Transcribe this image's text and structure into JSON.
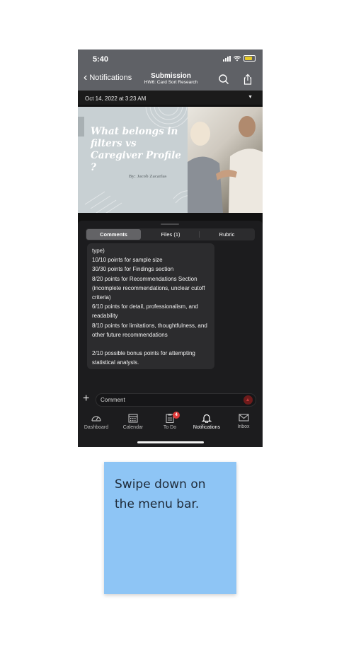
{
  "status_bar": {
    "time": "5:40"
  },
  "nav": {
    "back_label": "Notifications",
    "title": "Submission",
    "subtitle": "HW6: Card Sort Research"
  },
  "submission": {
    "date": "Oct 14, 2022 at 3:23 AM",
    "dropdown_icon": "triangle-down-icon"
  },
  "slide": {
    "title": "What belongs in filters vs Caregiver Profile ?",
    "author": "By: Jacob Zacarias"
  },
  "tabs": {
    "comments": "Comments",
    "files": "Files (1)",
    "rubric": "Rubric",
    "selected": "Comments"
  },
  "comment_text": "type)\n10/10 points for sample size\n30/30 points for Findings section\n8/20 points for Recommendations Section (incomplete recommendations, unclear cutoff criteria)\n6/10 points for detail, professionalism, and readability\n8/10 points for limitations, thoughtfulness, and other future recommendations\n\n2/10 possible bonus points for attempting statistical analysis.",
  "comment_input": {
    "placeholder": "Comment"
  },
  "tabbar": {
    "dashboard": "Dashboard",
    "calendar": "Calendar",
    "todo": "To Do",
    "todo_badge": "4",
    "notifications": "Notifications",
    "inbox": "Inbox",
    "active": "Notifications"
  },
  "instruction": "Swipe down on the menu bar.",
  "colors": {
    "badge": "#e03b3b",
    "note_bg": "#8ec5f5",
    "nav_bg": "#5f6166",
    "battery": "#e6c92a"
  }
}
